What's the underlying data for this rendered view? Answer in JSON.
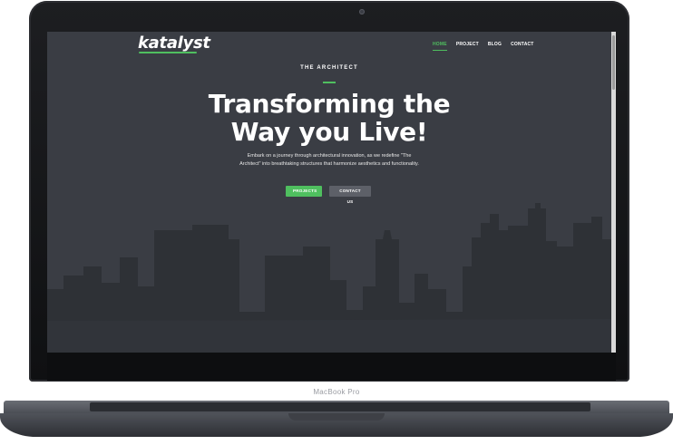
{
  "device": {
    "label": "MacBook Pro"
  },
  "site": {
    "logo": "katalyst",
    "nav": [
      {
        "label": "HOME",
        "active": true
      },
      {
        "label": "PROJECT",
        "active": false
      },
      {
        "label": "BLOG",
        "active": false
      },
      {
        "label": "CONTACT",
        "active": false
      }
    ],
    "hero": {
      "eyebrow": "THE ARCHITECT",
      "headline_line1": "Transforming the",
      "headline_line2": "Way you Live!",
      "subtext": "Embark on a journey through architectural innovation, as we redefine \"The Architect\" into breathtaking structures that harmonize aesthetics and functionality.",
      "primary_button": "PROJECTS",
      "secondary_button": "CONTACT US"
    }
  },
  "colors": {
    "accent": "#4fbf5f",
    "hero_bg": "#3a3d44",
    "skyline": "#2c2f35"
  }
}
